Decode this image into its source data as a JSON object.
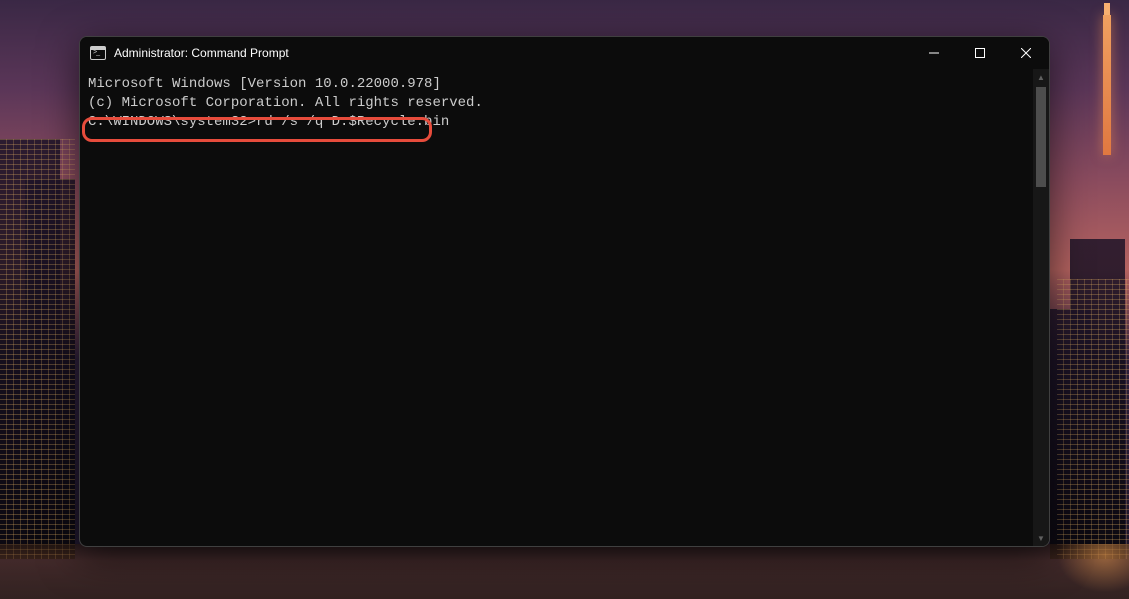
{
  "window": {
    "title": "Administrator: Command Prompt"
  },
  "terminal": {
    "line1": "Microsoft Windows [Version 10.0.22000.978]",
    "line2": "(c) Microsoft Corporation. All rights reserved.",
    "blank": "",
    "prompt": "C:\\WINDOWS\\system32>",
    "command": "rd /s /q D:$Recycle.bin"
  },
  "colors": {
    "highlight": "#e74c3c",
    "terminalBg": "#0c0c0c",
    "terminalFg": "#cccccc"
  }
}
